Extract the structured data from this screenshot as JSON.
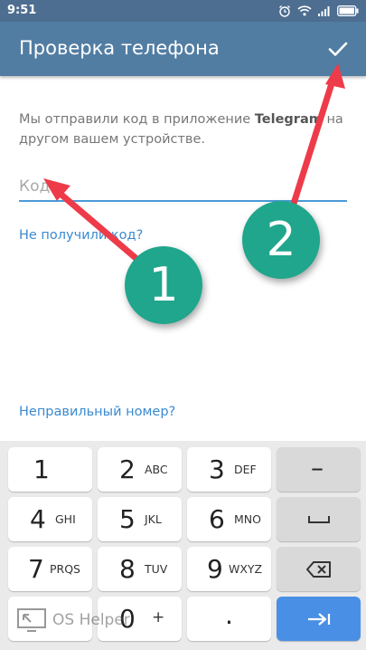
{
  "status_bar": {
    "time": "9:51",
    "icons": [
      "alarm-icon",
      "wifi-icon",
      "signal-icon",
      "battery-icon"
    ]
  },
  "app_bar": {
    "title": "Проверка телефона",
    "done_icon": "check-icon"
  },
  "content": {
    "info_text_prefix": "Мы отправили код в приложение ",
    "info_text_app": "Telegram",
    "info_text_suffix": " на другом вашем устройстве.",
    "code_placeholder": "Код",
    "code_value": "",
    "no_code_link": "Не получили код?",
    "wrong_number_link": "Неправильный номер?"
  },
  "keyboard": {
    "keys": [
      {
        "num": "1",
        "sub": ""
      },
      {
        "num": "2",
        "sub": "ABC"
      },
      {
        "num": "3",
        "sub": "DEF"
      },
      {
        "num": "4",
        "sub": "GHI"
      },
      {
        "num": "5",
        "sub": "JKL"
      },
      {
        "num": "6",
        "sub": "MNO"
      },
      {
        "num": "7",
        "sub": "PRQS"
      },
      {
        "num": "8",
        "sub": "TUV"
      },
      {
        "num": "9",
        "sub": "WXYZ"
      },
      {
        "num": "",
        "sub": ""
      },
      {
        "num": "0",
        "sub": "+"
      },
      {
        "num": ".",
        "sub": ""
      }
    ],
    "side_keys": {
      "minus": "–",
      "space": "space-icon",
      "backspace": "backspace-icon",
      "enter": "enter-icon"
    }
  },
  "annotations": {
    "badge1": "1",
    "badge2": "2",
    "arrow_color": "#ee3b49",
    "badge_color": "#1fa68c"
  },
  "watermark": {
    "text": "OS Helper"
  },
  "colors": {
    "app_bar": "#527da3",
    "status_bar": "#4d6e91",
    "accent": "#4a9bd7",
    "link": "#3a8ad1",
    "enter_key": "#4a8fe6"
  }
}
